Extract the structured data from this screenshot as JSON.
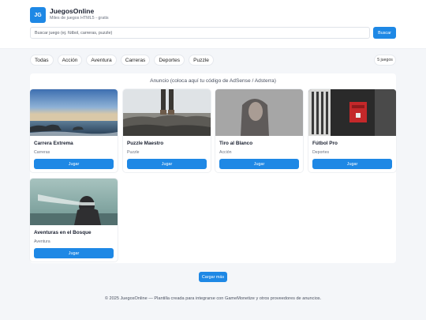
{
  "header": {
    "logo_text": "JG",
    "site_name": "JuegosOnline",
    "tagline": "Miles de juegos HTML5 - gratis",
    "search_placeholder": "Buscar juego (ej. fútbol, carreras, puzzle)",
    "search_value": "",
    "search_button": "Buscar"
  },
  "categories": [
    "Todas",
    "Acción",
    "Aventura",
    "Carreras",
    "Deportes",
    "Puzzle"
  ],
  "game_count": "5 juegos",
  "ad_text": "Anuncio (coloca aquí tu código de AdSense / Adsterra)",
  "games": [
    {
      "title": "Carrera Extrema",
      "category": "Carreras",
      "play": "Jugar",
      "thumbnail": "seascape-rocks"
    },
    {
      "title": "Puzzle Maestro",
      "category": "Puzzle",
      "play": "Jugar",
      "thumbnail": "legs-on-rocks"
    },
    {
      "title": "Tiro al Blanco",
      "category": "Acción",
      "play": "Jugar",
      "thumbnail": "woman-portrait"
    },
    {
      "title": "Fútbol Pro",
      "category": "Deportes",
      "play": "Jugar",
      "thumbnail": "red-mailbox"
    },
    {
      "title": "Aventuras en el Bosque",
      "category": "Aventura",
      "play": "Jugar",
      "thumbnail": "woman-blindfold"
    }
  ],
  "load_more": "Cargar más",
  "footer": "© 2025 JuegosOnline — Plantilla creada para integrarse con GameMonetize y otros proveedores de anuncios.",
  "colors": {
    "accent": "#1e88e5",
    "background": "#f4f6f9"
  }
}
